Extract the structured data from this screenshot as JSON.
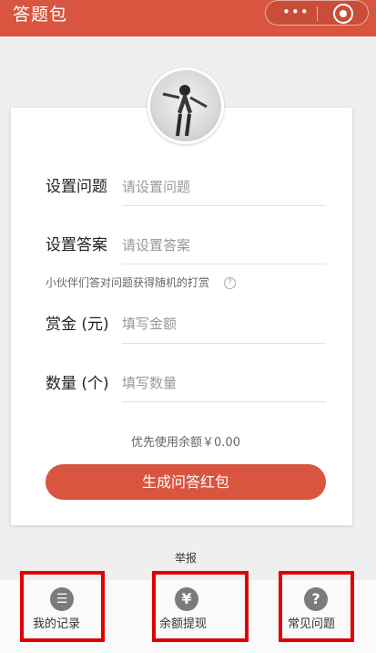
{
  "header": {
    "title": "答题包",
    "more_glyph": "•••"
  },
  "form": {
    "question_label": "设置问题",
    "question_placeholder": "请设置问题",
    "answer_label": "设置答案",
    "answer_placeholder": "请设置答案",
    "hint": "小伙伴们答对问题获得随机的打赏",
    "hint_icon": "?",
    "reward_label": "赏金 (元)",
    "reward_placeholder": "填写金额",
    "count_label": "数量 (个)",
    "count_placeholder": "填写数量",
    "balance_text": "优先使用余额￥0.00",
    "generate_button": "生成问答红包"
  },
  "report_link": "举报",
  "tabbar": {
    "items": [
      {
        "icon": "list-icon",
        "glyph": "☰",
        "label": "我的记录"
      },
      {
        "icon": "yen-icon",
        "glyph": "¥",
        "label": "余额提现"
      },
      {
        "icon": "question-icon",
        "glyph": "?",
        "label": "常见问题"
      }
    ]
  },
  "colors": {
    "accent": "#d9553f",
    "highlight_border": "#e00000",
    "tab_icon": "#7b7b7b"
  }
}
